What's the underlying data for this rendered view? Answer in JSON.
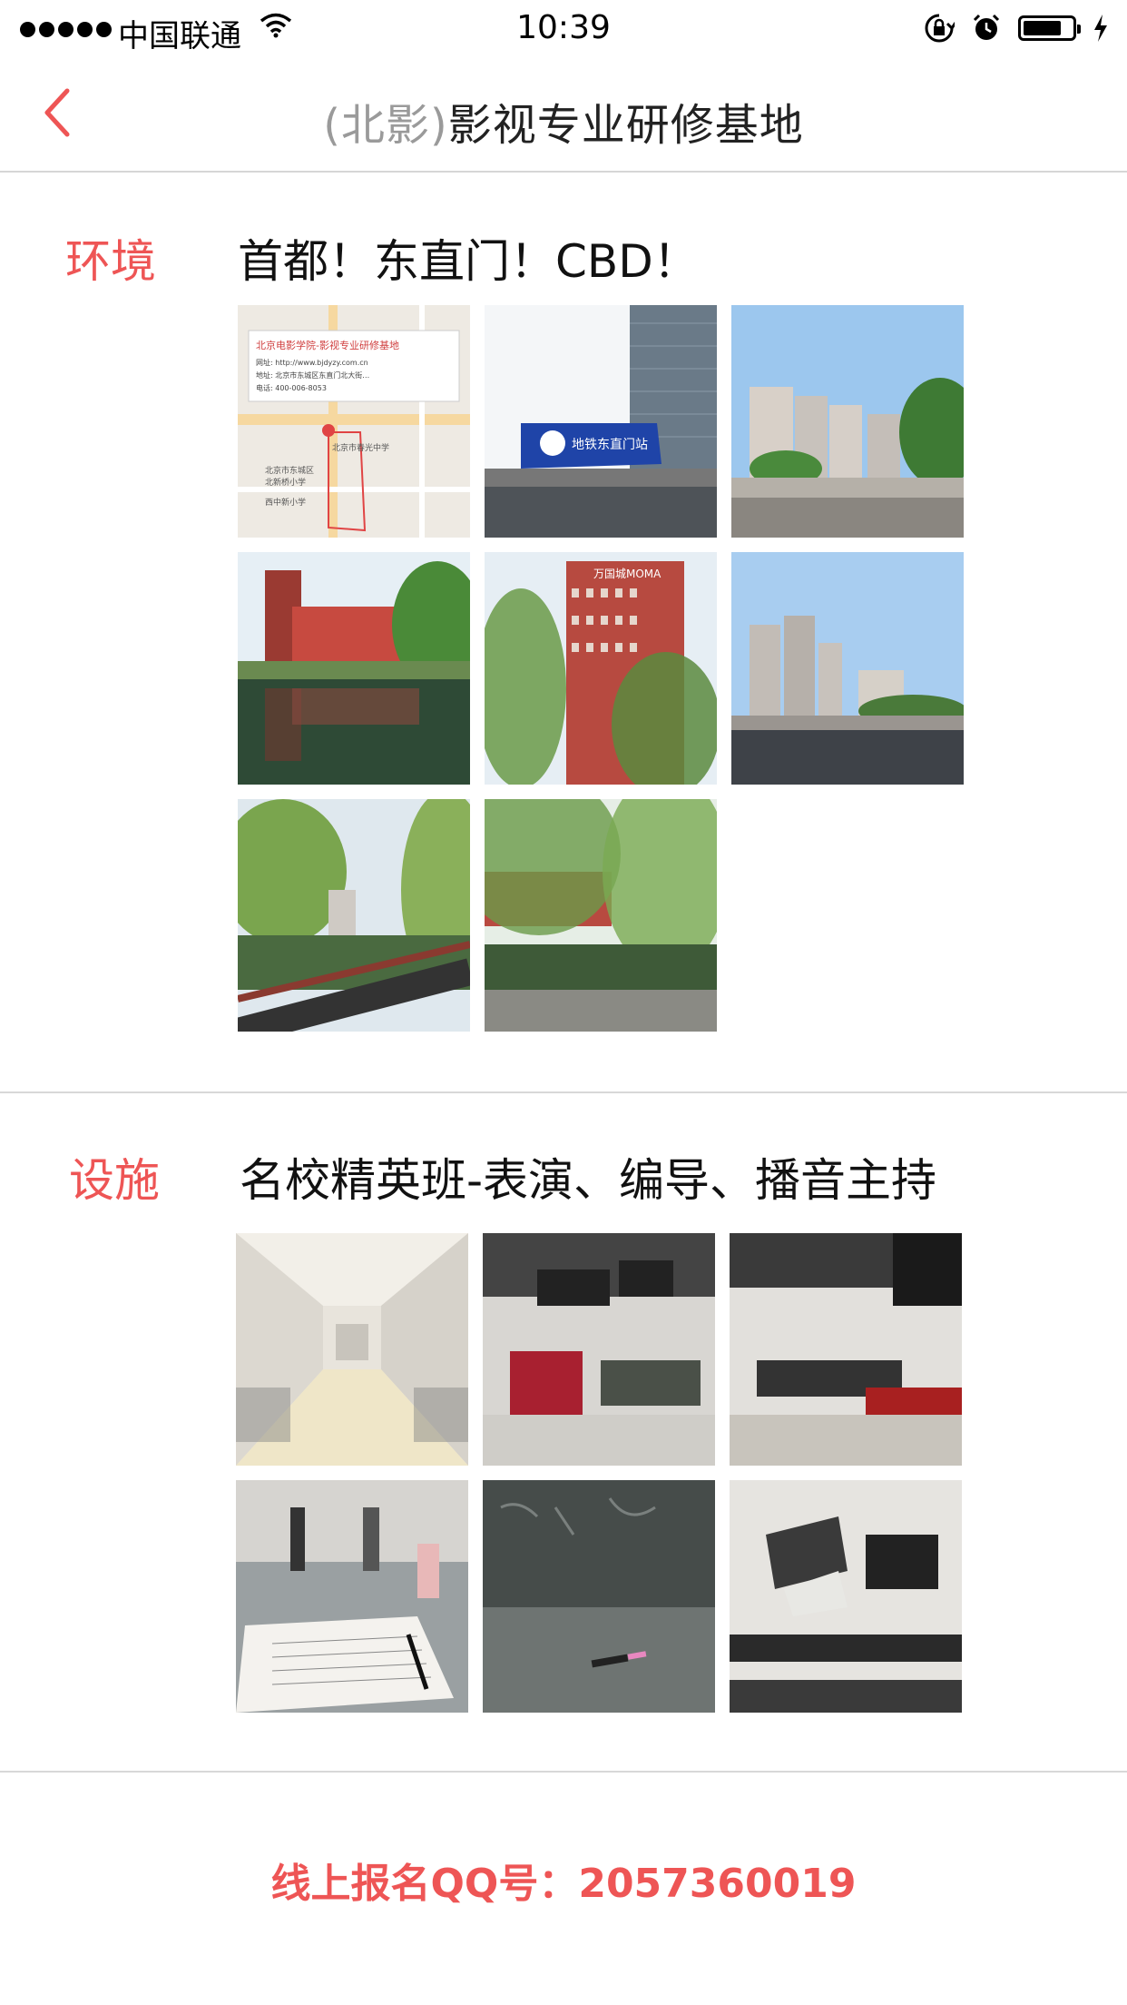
{
  "status_bar": {
    "carrier": "中国联通",
    "time": "10:39"
  },
  "nav": {
    "title_prefix": "(北影)",
    "title_main": "影视专业研修基地",
    "back_icon": "chevron-left-icon",
    "accent_color": "#ee5555"
  },
  "environment": {
    "label": "环境",
    "title": "首都！东直门！CBD！",
    "map_lines": [
      "北京电影学院-影视专业研修基地",
      "网址: http://www.bjdyzy.com.cn",
      "地址: 北京市东城区东直门北大街…",
      "电话: 400-006-8053"
    ],
    "map_labels": [
      "北京市春光中学",
      "北京市东城区",
      "北新桥小学",
      "西中新小学"
    ],
    "sign_text": "地铁东直门站",
    "building_sign": "万国城MOMA",
    "photos": [
      {
        "name": "map-photo"
      },
      {
        "name": "subway-station-photo"
      },
      {
        "name": "residential-towers-photo"
      },
      {
        "name": "canal-reflection-photo"
      },
      {
        "name": "moma-building-photo"
      },
      {
        "name": "city-road-photo"
      },
      {
        "name": "willow-canal-photo"
      },
      {
        "name": "canal-walkway-photo"
      }
    ]
  },
  "facilities": {
    "label": "设施",
    "title": "名校精英班-表演、编导、播音主持",
    "photos": [
      {
        "name": "corridor-photo"
      },
      {
        "name": "studio-curtain-photo"
      },
      {
        "name": "studio-tv-photo"
      },
      {
        "name": "classroom-notes-photo"
      },
      {
        "name": "blackboard-photo"
      },
      {
        "name": "stage-lights-photo"
      }
    ]
  },
  "footer": {
    "qq_text": "线上报名QQ号：2057360019"
  }
}
